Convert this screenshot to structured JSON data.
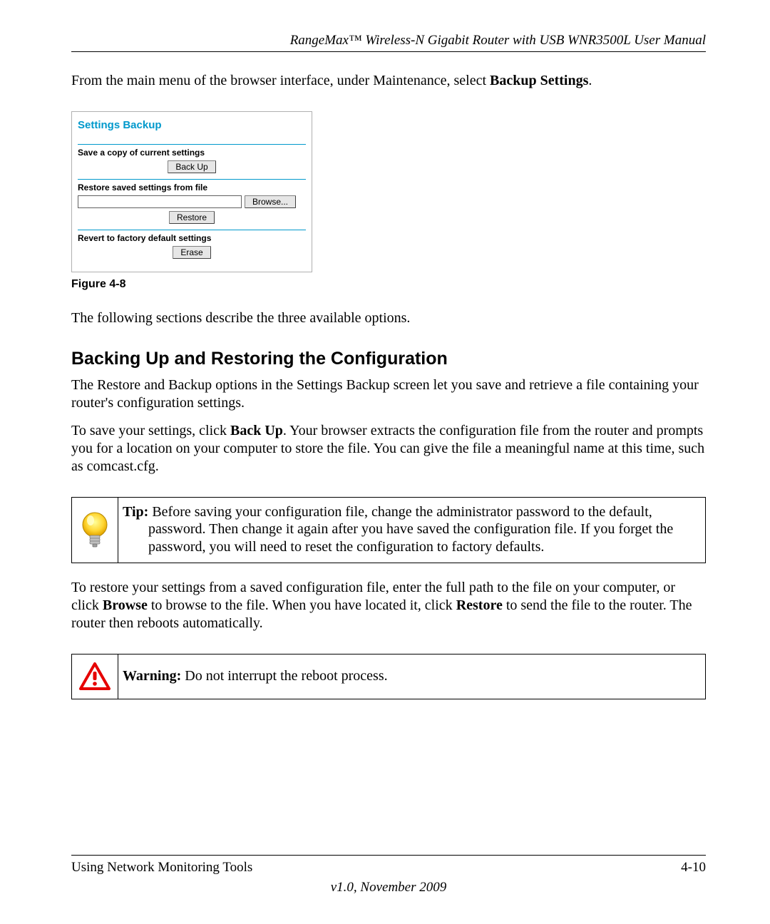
{
  "header": {
    "running_title": "RangeMax™ Wireless-N Gigabit Router with USB WNR3500L User Manual"
  },
  "intro": {
    "p1_pre": "From the main menu of the browser interface, under Maintenance, select ",
    "p1_bold": "Backup Settings",
    "p1_post": "."
  },
  "ui": {
    "title": "Settings Backup",
    "save_label": "Save a copy of current settings",
    "backup_btn": "Back Up",
    "restore_label": "Restore saved settings from file",
    "file_value": "",
    "browse_btn": "Browse...",
    "restore_btn": "Restore",
    "revert_label": "Revert to factory default settings",
    "erase_btn": "Erase"
  },
  "figure_label": "Figure 4-8",
  "after_figure": "The following sections describe the three available options.",
  "section": {
    "heading": "Backing Up and Restoring the Configuration",
    "p1": "The Restore and Backup options in the Settings Backup screen let you save and retrieve a file containing your router's configuration settings.",
    "p2_a": "To save your settings, click ",
    "p2_b": "Back Up",
    "p2_c": ". Your browser extracts the configuration file from the router and prompts you for a location on your computer to store the file. You can give the file a meaningful name at this time, such as comcast.cfg."
  },
  "tip": {
    "label": "Tip:",
    "a": " Before saving your configuration file, change the administrator password to the default, ",
    "b": "password",
    "c": ". Then change it again after you have saved the configuration file. If you forget the password, you will need to reset the configuration to factory defaults."
  },
  "restore_para": {
    "a": "To restore your settings from a saved configuration file, enter the full path to the file on your computer, or click ",
    "b": "Browse",
    "c": " to browse to the file. When you have located it, click ",
    "d": "Restore",
    "e": " to send the file to the router. The router then reboots automatically."
  },
  "warning": {
    "label": "Warning:",
    "text": " Do not interrupt the reboot process."
  },
  "footer": {
    "left": "Using Network Monitoring Tools",
    "right": "4-10",
    "version": "v1.0, November 2009"
  }
}
